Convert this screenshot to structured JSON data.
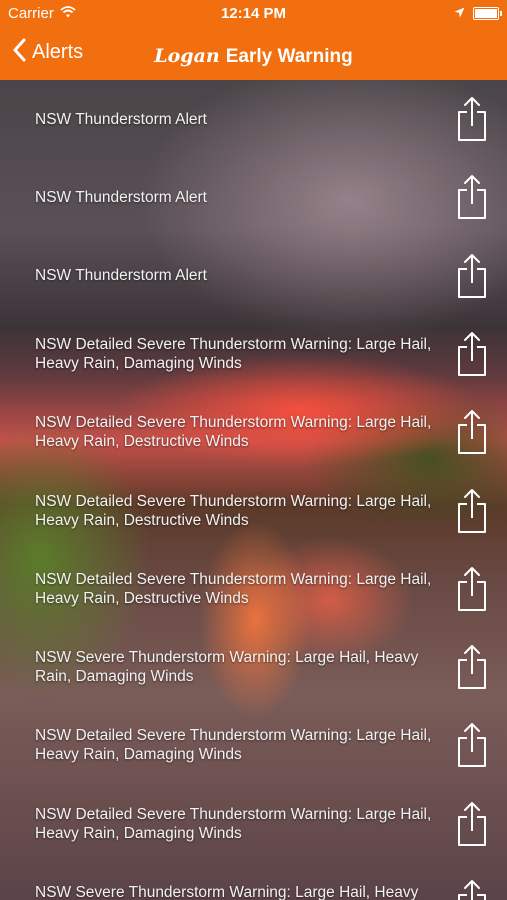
{
  "status_bar": {
    "carrier": "Carrier",
    "time": "12:14 PM"
  },
  "nav": {
    "back_label": "Alerts",
    "title_brand": "Logan",
    "title_rest": "Early Warning",
    "accent_color": "#f26f0f"
  },
  "alerts": [
    {
      "title": "NSW Thunderstorm Alert"
    },
    {
      "title": "NSW Thunderstorm Alert"
    },
    {
      "title": "NSW Thunderstorm Alert"
    },
    {
      "title": "NSW Detailed Severe Thunderstorm Warning: Large Hail, Heavy Rain, Damaging Winds"
    },
    {
      "title": "NSW Detailed Severe Thunderstorm Warning: Large Hail, Heavy Rain, Destructive Winds"
    },
    {
      "title": "NSW Detailed Severe Thunderstorm Warning: Large Hail, Heavy Rain, Destructive Winds"
    },
    {
      "title": "NSW Detailed Severe Thunderstorm Warning: Large Hail, Heavy Rain, Destructive Winds"
    },
    {
      "title": "NSW Severe Thunderstorm Warning: Large Hail, Heavy Rain, Damaging Winds"
    },
    {
      "title": "NSW Detailed Severe Thunderstorm Warning: Large Hail, Heavy Rain, Damaging Winds"
    },
    {
      "title": "NSW Detailed Severe Thunderstorm Warning: Large Hail, Heavy Rain, Damaging Winds"
    },
    {
      "title": "NSW Severe Thunderstorm Warning: Large Hail, Heavy Rain, Damaging Winds"
    }
  ],
  "icons": {
    "wifi": "wifi-icon",
    "location": "location-arrow-icon",
    "battery": "battery-icon",
    "back": "chevron-left-icon",
    "share": "share-icon"
  }
}
